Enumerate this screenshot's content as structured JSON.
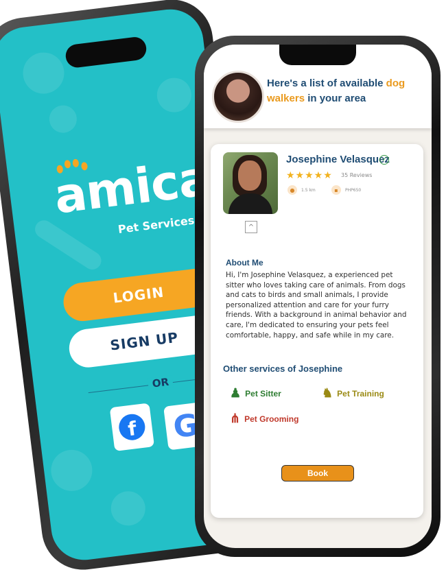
{
  "back_phone": {
    "logo": "amica",
    "subtitle": "Pet Services",
    "login_label": "LOGIN",
    "signup_label": "SIGN UP",
    "or_label": "OR",
    "facebook_glyph": "f",
    "google_glyph": "G",
    "colors": {
      "background": "#23c0c7",
      "accent": "#f6a623",
      "text_dark": "#173b64"
    }
  },
  "front_phone": {
    "header": {
      "prefix": "Here's a list of available ",
      "highlight": "dog walkers",
      "suffix": " in your area"
    },
    "walker": {
      "name": "Josephine Velasquez",
      "stars": "★★★★★",
      "reviews": "35 Reviews",
      "distance": "1.5 km",
      "price": "PHP650",
      "verified_glyph": "✓"
    },
    "about": {
      "title": "About Me",
      "text": "Hi, I'm Josephine Velasquez, a experienced pet sitter who loves taking care of animals. From dogs and cats to birds and small animals, I provide personalized attention and care for your furry friends. With a background in animal behavior and care, I'm dedicated to ensuring your pets feel comfortable, happy, and safe while in my care."
    },
    "other_services": {
      "title": "Other services of Josephine",
      "items": [
        {
          "label": "Pet Sitter",
          "icon": "person-icon",
          "color": "#2e7d32"
        },
        {
          "label": "Pet Training",
          "icon": "training-icon",
          "color": "#9a8a14"
        },
        {
          "label": "Pet Grooming",
          "icon": "comb-icon",
          "color": "#c0392b"
        }
      ]
    },
    "book_label": "Book",
    "colors": {
      "title_blue": "#1f4c73",
      "accent_orange": "#ea9a1e",
      "star": "#f2b21e"
    }
  }
}
